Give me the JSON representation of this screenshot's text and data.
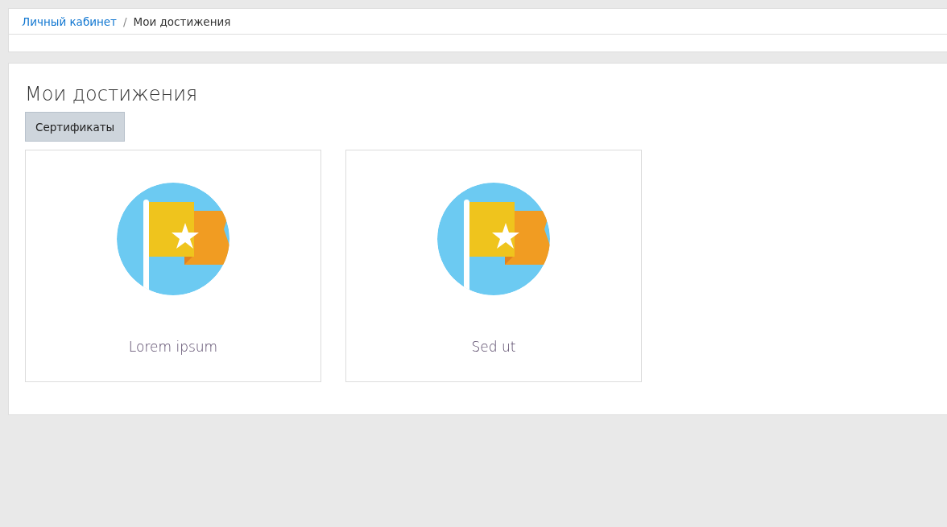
{
  "breadcrumb": [
    {
      "label": "Личный кабинет",
      "kind": "link"
    },
    {
      "label": "Мои достижения",
      "kind": "current"
    }
  ],
  "breadcrumb_separator": "/",
  "page_title": "Мои достижения",
  "buttons": [
    "Сертификаты"
  ],
  "achievements": [
    {
      "name": "Lorem ipsum"
    },
    {
      "name": "Sed ut"
    }
  ]
}
